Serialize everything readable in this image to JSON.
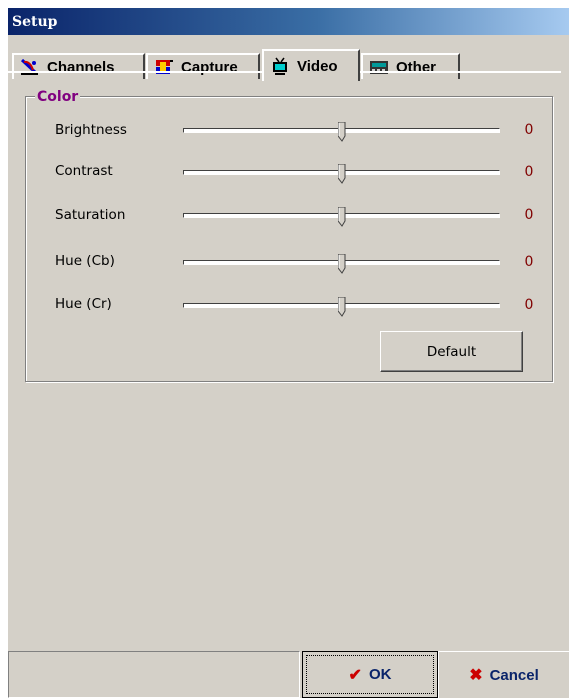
{
  "window": {
    "title": "Setup"
  },
  "tabs": [
    {
      "label": "Channels",
      "icon": "satellite-dish-icon",
      "active": false
    },
    {
      "label": "Capture",
      "icon": "capture-card-icon",
      "active": false
    },
    {
      "label": "Video",
      "icon": "tv-icon",
      "active": true
    },
    {
      "label": "Other",
      "icon": "device-icon",
      "active": false
    }
  ],
  "color_group": {
    "legend": "Color",
    "rows": [
      {
        "label": "Brightness",
        "value": "0",
        "level": 0.5
      },
      {
        "label": "Contrast",
        "value": "0",
        "level": 0.5
      },
      {
        "label": "Saturation",
        "value": "0",
        "level": 0.5
      },
      {
        "label": "Hue (Cb)",
        "value": "0",
        "level": 0.5
      },
      {
        "label": "Hue (Cr)",
        "value": "0",
        "level": 0.5
      }
    ],
    "default_button": "Default"
  },
  "footer": {
    "ok_label": "OK",
    "cancel_label": "Cancel"
  },
  "colors": {
    "title_bar": "#0a246a",
    "group_legend": "#800080",
    "slider_value": "#800000",
    "button_text": "#0a246a",
    "icon_red": "#cc0000"
  }
}
